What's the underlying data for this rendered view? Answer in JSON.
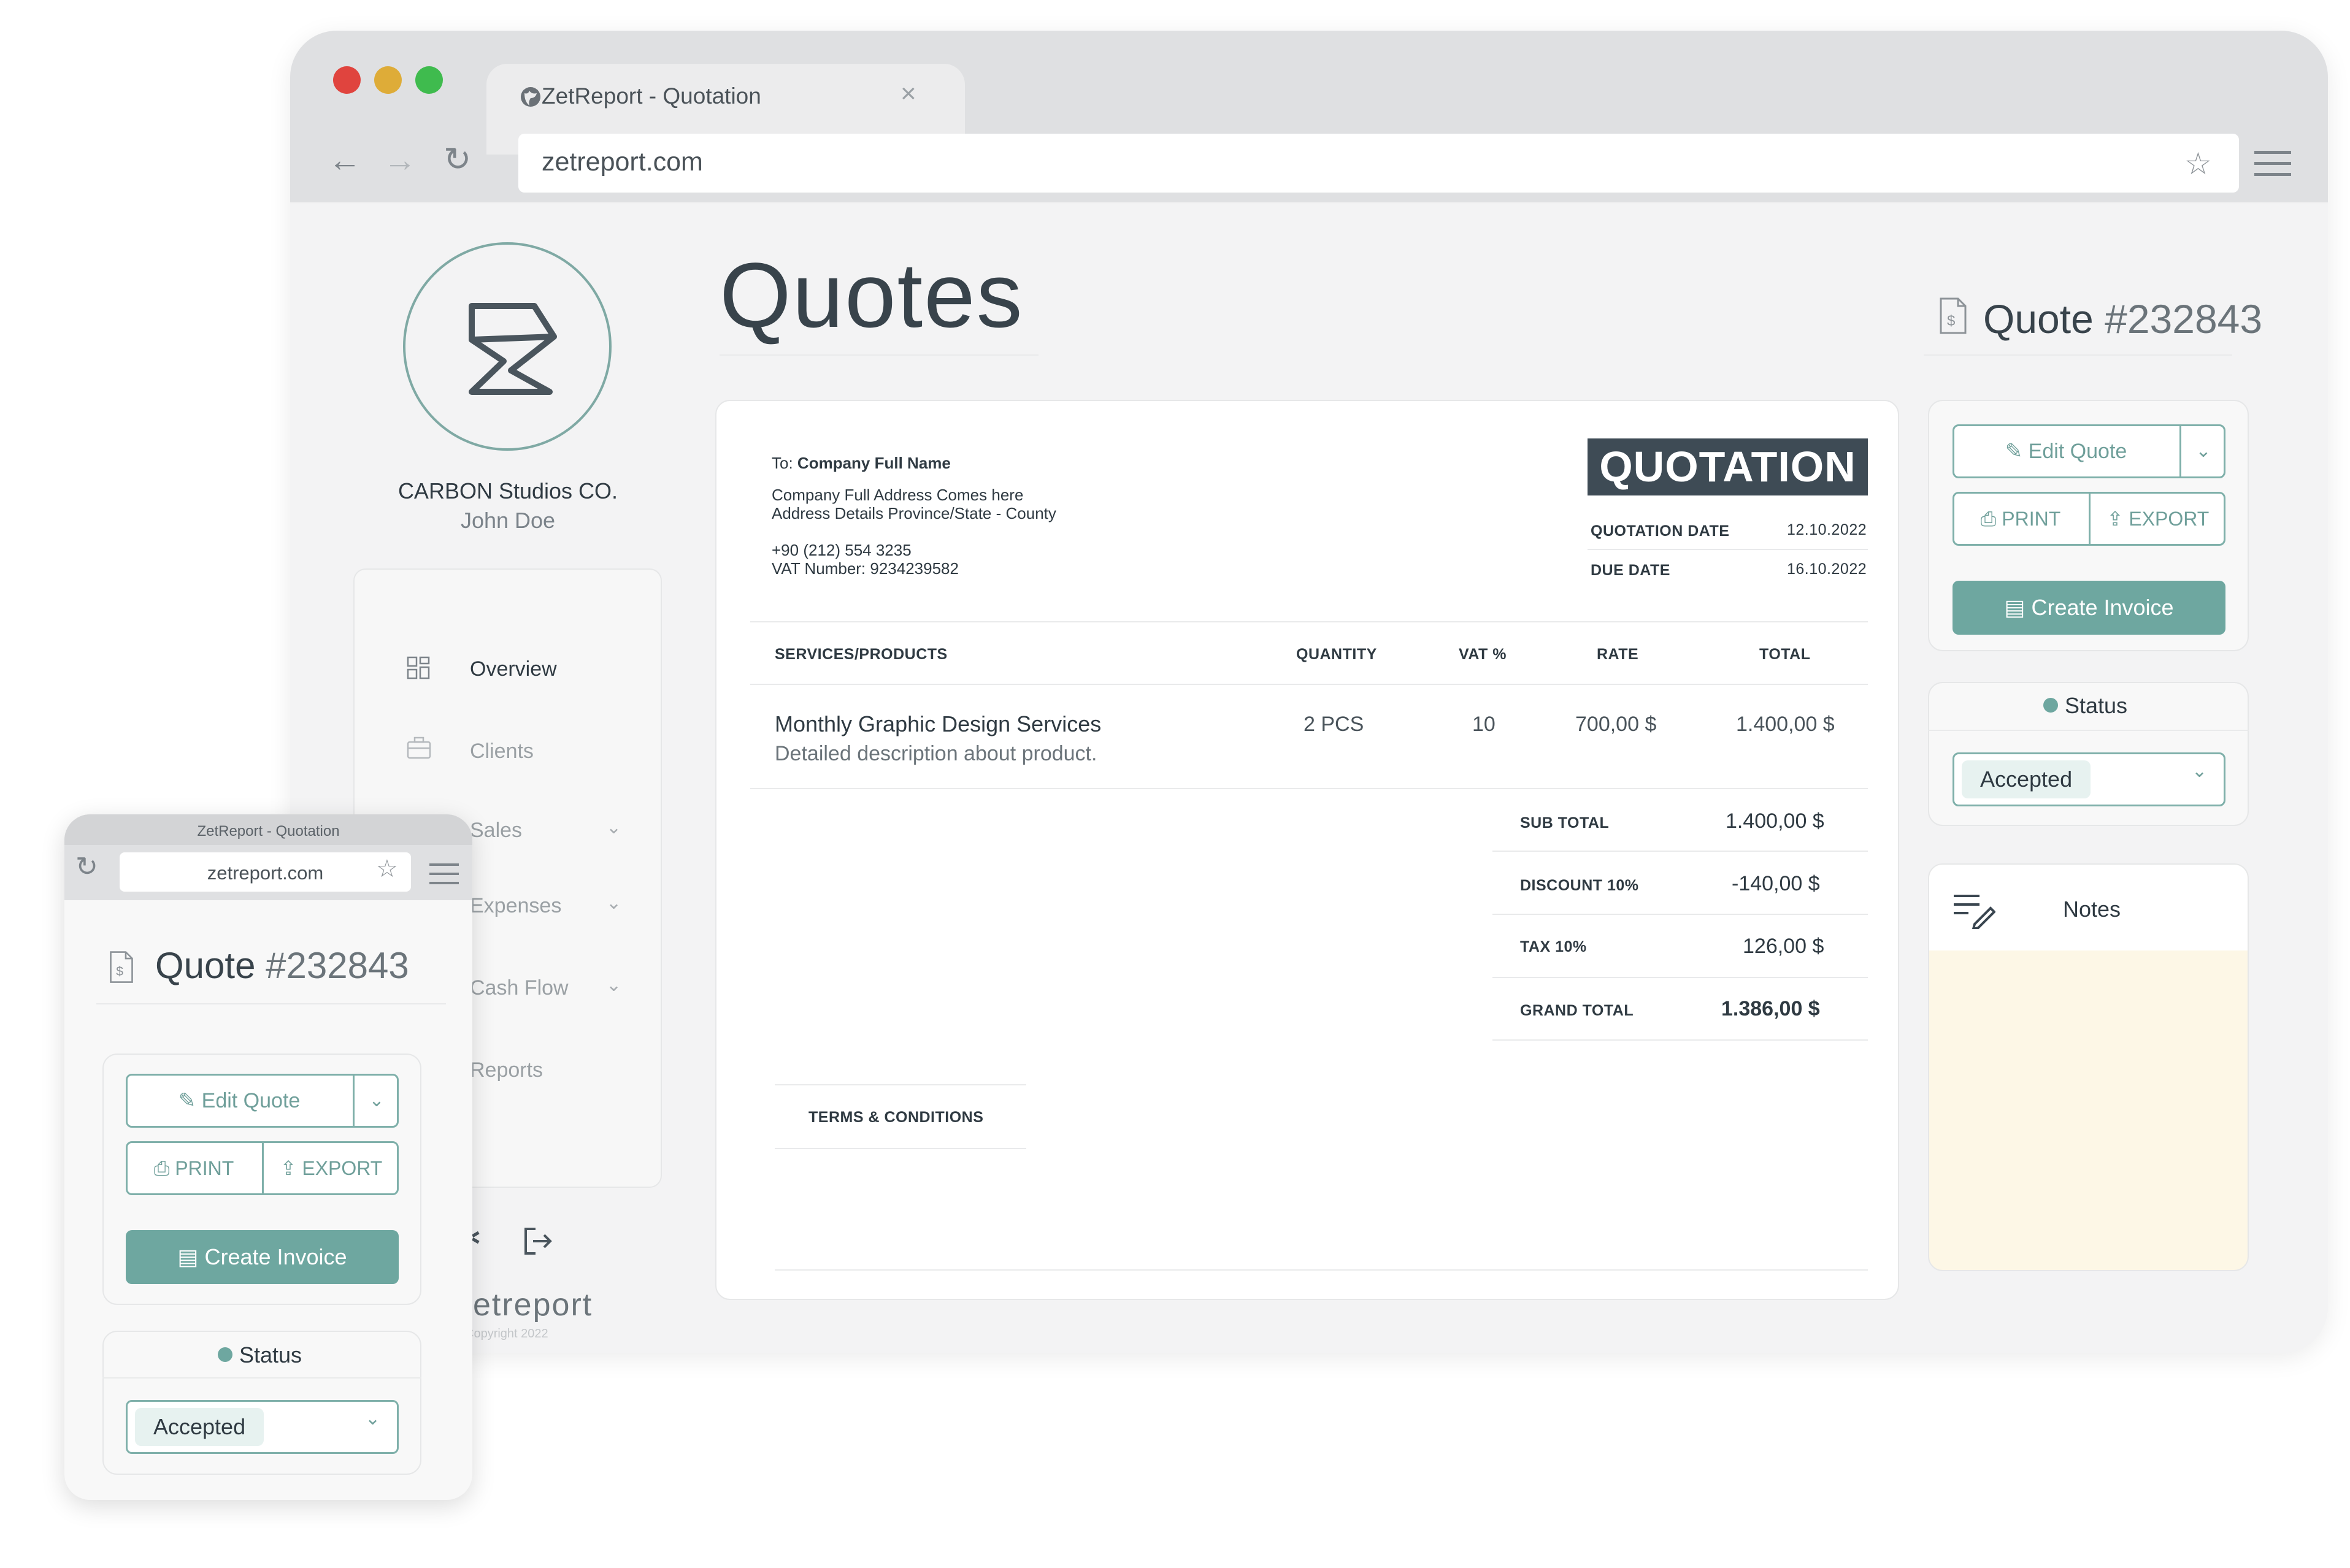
{
  "desktop": {
    "tab_title": "ZetReport - Quotation",
    "url": "zetreport.com",
    "company_name": "CARBON Studios CO.",
    "user_name": "John Doe",
    "nav": {
      "overview": "Overview",
      "clients": "Clients",
      "sales": "Sales",
      "expenses": "Expenses",
      "cash_flow": "Cash Flow",
      "reports": "Reports"
    },
    "brand_footer": "zetreport",
    "copyright": "Copyright 2022",
    "page_title": "Quotes",
    "quote": {
      "label": "Quote",
      "number": "#232843"
    },
    "document": {
      "to_prefix": "To:",
      "to_name": "Company Full Name",
      "address_line1": "Company Full Address Comes here",
      "address_line2": "Address Details Province/State  - County",
      "phone": "+90 (212) 554 3235",
      "vat_number": "VAT Number: 9234239582",
      "badge": "QUOTATION",
      "quotation_date_label": "QUOTATION DATE",
      "quotation_date": "12.10.2022",
      "due_date_label": "DUE DATE",
      "due_date": "16.10.2022",
      "columns": {
        "services": "SERVICES/PRODUCTS",
        "quantity": "QUANTITY",
        "vat": "VAT %",
        "rate": "RATE",
        "total": "TOTAL"
      },
      "items": [
        {
          "name": "Monthly Graphic Design Services",
          "description": "Detailed description about product.",
          "quantity": "2 PCS",
          "vat": "10",
          "rate": "700,00 $",
          "total": "1.400,00 $"
        }
      ],
      "sub_total_label": "SUB TOTAL",
      "sub_total": "1.400,00 $",
      "discount_label": "DISCOUNT 10%",
      "discount": "-140,00 $",
      "tax_label": "TAX 10%",
      "tax": "126,00 $",
      "grand_total_label": "GRAND TOTAL",
      "grand_total": "1.386,00 $",
      "terms_label": "TERMS & CONDITIONS"
    },
    "actions": {
      "edit_quote": "Edit Quote",
      "print": "PRINT",
      "export": "EXPORT",
      "create_invoice": "Create Invoice"
    },
    "status": {
      "label": "Status",
      "value": "Accepted"
    },
    "notes_label": "Notes"
  },
  "mobile": {
    "tab_title": "ZetReport - Quotation",
    "url": "zetreport.com",
    "quote_label": "Quote",
    "quote_number": "#232843",
    "edit_quote": "Edit Quote",
    "print": "PRINT",
    "export": "EXPORT",
    "create_invoice": "Create Invoice",
    "status_label": "Status",
    "status_value": "Accepted"
  },
  "colors": {
    "accent": "#6ea7a0",
    "dark_badge": "#3e4b55",
    "notes_bg": "#fdf7e6",
    "traffic_red": "#e0443e",
    "traffic_yellow": "#deac38",
    "traffic_green": "#3fbb4e"
  }
}
